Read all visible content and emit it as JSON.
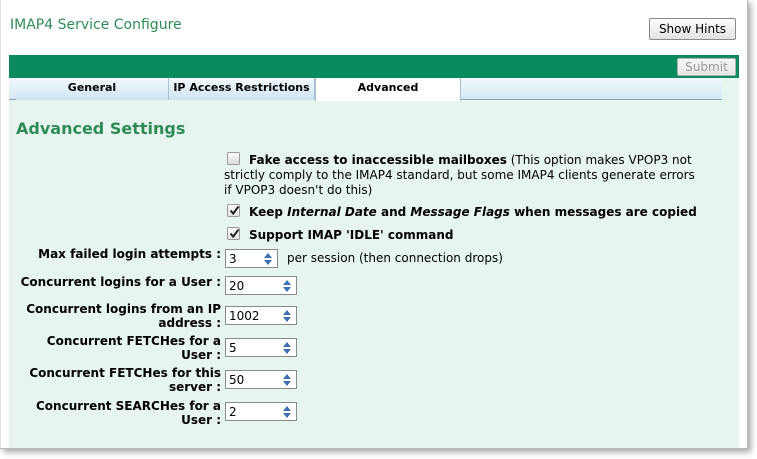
{
  "window": {
    "title": "IMAP4 Service Configure",
    "show_hints_label": "Show Hints",
    "submit_label": "Submit"
  },
  "tabs": [
    {
      "label": "General",
      "active": false
    },
    {
      "label": "IP Access Restrictions",
      "active": false
    },
    {
      "label": "Advanced",
      "active": true
    }
  ],
  "section": {
    "title": "Advanced Settings"
  },
  "options": {
    "fake_access": {
      "checked": false,
      "label_bold": "Fake access to inaccessible mailboxes",
      "line1_rest": " (This option makes VPOP3 not",
      "line2": "strictly comply to the IMAP4 standard, but some IMAP4 clients generate errors",
      "line3": "if VPOP3 doesn't do this)"
    },
    "keep_dates": {
      "checked": true,
      "part1": "Keep ",
      "part2": "Internal Date",
      "part3": " and ",
      "part4": "Message Flags",
      "part5": " when messages are copied"
    },
    "idle": {
      "checked": true,
      "label": "Support IMAP 'IDLE' command"
    }
  },
  "fields": {
    "max_failed": {
      "label": "Max failed login attempts :",
      "value": "3",
      "suffix": "per session (then connection drops)"
    },
    "logins_user": {
      "label": "Concurrent logins for a User :",
      "value": "20"
    },
    "logins_ip": {
      "label_line1": "Concurrent logins from an IP",
      "label_line2": "address :",
      "value": "1002"
    },
    "fetches_user": {
      "label_line1": "Concurrent FETCHes for a",
      "label_line2": "User :",
      "value": "5"
    },
    "fetches_server": {
      "label_line1": "Concurrent FETCHes for this",
      "label_line2": "server :",
      "value": "50"
    },
    "searches_user": {
      "label_line1": "Concurrent SEARCHes for a",
      "label_line2": "User :",
      "value": "2"
    }
  },
  "colors": {
    "accent_green": "#2e8b57",
    "bar_green": "#0a8b5e",
    "panel_bg": "#e6f5ee",
    "spinner_arrow": "#3c6fb4"
  }
}
